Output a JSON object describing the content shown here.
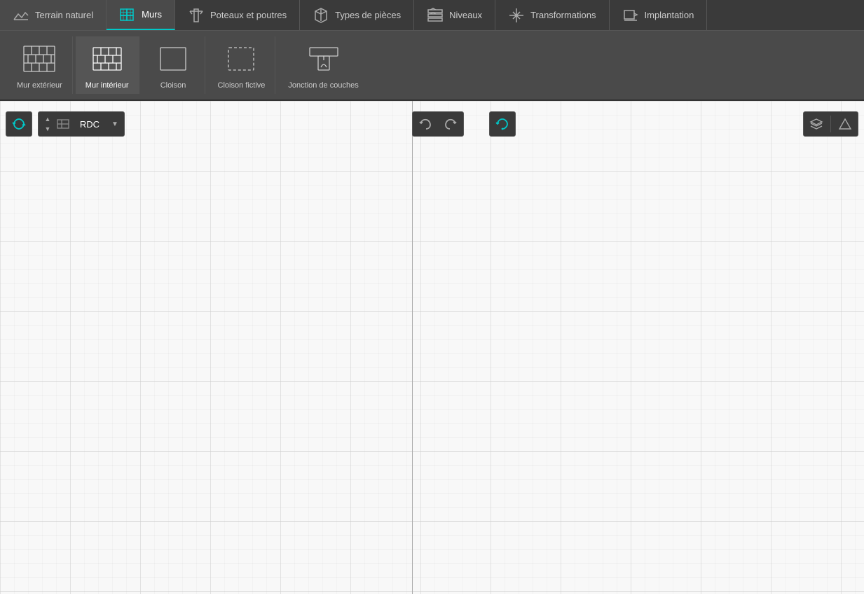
{
  "nav": {
    "items": [
      {
        "id": "terrain",
        "label": "Terrain naturel",
        "active": false
      },
      {
        "id": "murs",
        "label": "Murs",
        "active": true
      },
      {
        "id": "poteaux",
        "label": "Poteaux et poutres",
        "active": false
      },
      {
        "id": "types",
        "label": "Types de pièces",
        "active": false
      },
      {
        "id": "niveaux",
        "label": "Niveaux",
        "active": false
      },
      {
        "id": "transformations",
        "label": "Transformations",
        "active": false
      },
      {
        "id": "implantation",
        "label": "Implantation",
        "active": false
      }
    ]
  },
  "subtoolbar": {
    "items": [
      {
        "id": "mur-ext",
        "label": "Mur extérieur",
        "active": false
      },
      {
        "id": "mur-int",
        "label": "Mur intérieur",
        "active": false
      },
      {
        "id": "cloison",
        "label": "Cloison",
        "active": false
      },
      {
        "id": "cloison-fictive",
        "label": "Cloison fictive",
        "active": false
      },
      {
        "id": "jonction",
        "label": "Jonction de couches",
        "active": false
      }
    ]
  },
  "toolbar": {
    "reverse_label": "↔",
    "level": "RDC",
    "undo_label": "↩",
    "redo_label": "↪",
    "refresh_label": "⟳"
  },
  "canvas": {
    "background": "#f8f8f8",
    "grid_color": "#ddd"
  }
}
